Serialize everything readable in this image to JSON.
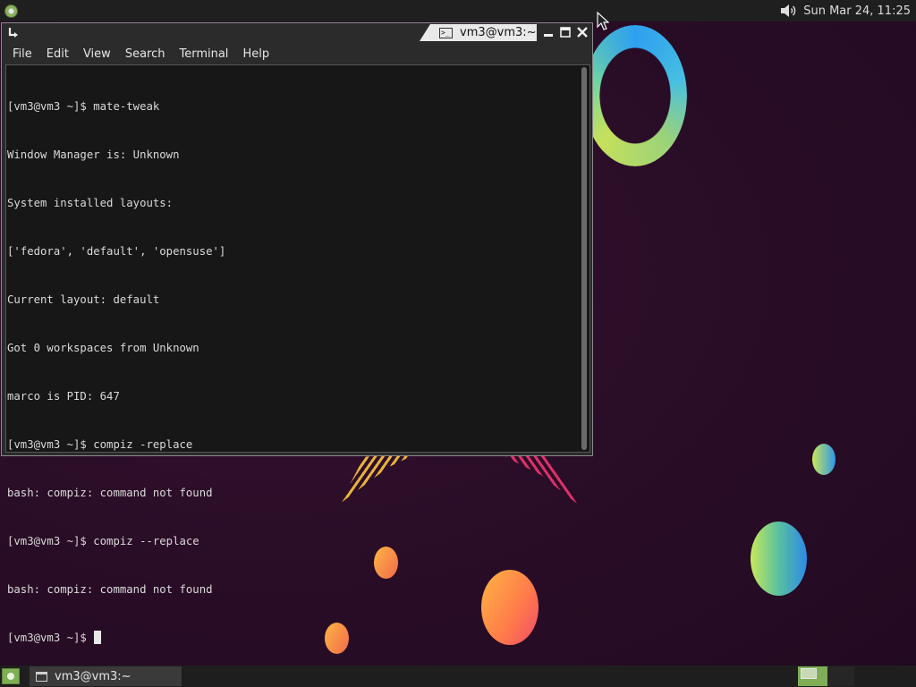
{
  "top_panel": {
    "menu_icon": "mate-menu-icon",
    "volume_icon": "volume-icon",
    "clock": "Sun Mar 24, 11:25"
  },
  "window": {
    "title": "vm3@vm3:~",
    "title_icon": "terminal-icon",
    "menu_icon": "window-menu-arrow-icon",
    "buttons": {
      "minimize": "minimize-icon",
      "maximize": "maximize-icon",
      "close": "close-icon"
    },
    "menus": [
      "File",
      "Edit",
      "View",
      "Search",
      "Terminal",
      "Help"
    ],
    "terminal_lines": [
      "[vm3@vm3 ~]$ mate-tweak",
      "Window Manager is: Unknown",
      "System installed layouts:",
      "['fedora', 'default', 'opensuse']",
      "Current layout: default",
      "Got 0 workspaces from Unknown",
      "marco is PID: 647",
      "[vm3@vm3 ~]$ compiz -replace",
      "bash: compiz: command not found",
      "[vm3@vm3 ~]$ compiz --replace",
      "bash: compiz: command not found"
    ],
    "prompt": "[vm3@vm3 ~]$"
  },
  "bottom_panel": {
    "show_desktop_icon": "show-desktop-icon",
    "task_label": "vm3@vm3:~",
    "task_icon": "window-icon"
  },
  "colors": {
    "panel": "#1f1f1f",
    "terminal_bg": "#171717",
    "accent_green": "#7fae56",
    "wallpaper": "#2a0d27"
  }
}
